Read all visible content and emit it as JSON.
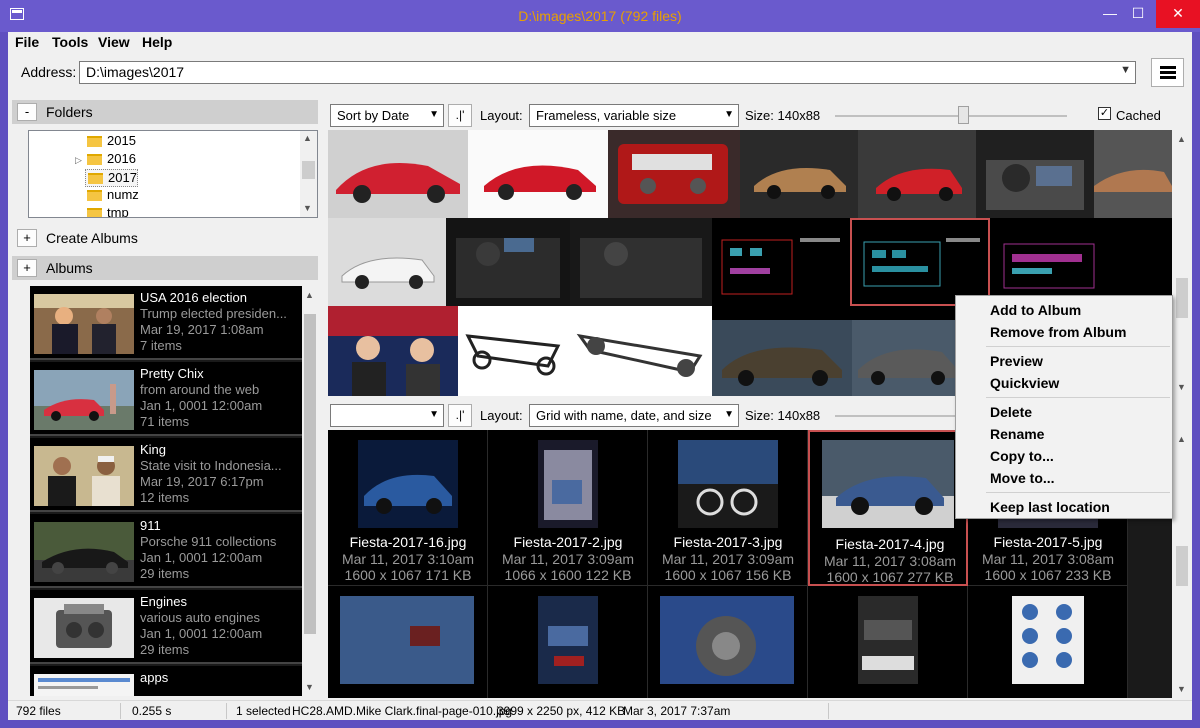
{
  "window": {
    "title": "D:\\images\\2017 (792 files)",
    "minimize": "—",
    "maximize": "☐",
    "close": "✕"
  },
  "menu": [
    "File",
    "Tools",
    "View",
    "Help"
  ],
  "address": {
    "label": "Address:",
    "value": "D:\\images\\2017"
  },
  "folders": {
    "header": "Folders",
    "toggle": "-",
    "items": [
      "2015",
      "2016",
      "2017",
      "numz",
      "tmp"
    ],
    "selected": "2017"
  },
  "create_albums": {
    "toggle": "+",
    "label": "Create Albums"
  },
  "albums": {
    "toggle": "+",
    "header": "Albums",
    "items": [
      {
        "title": "USA 2016 election",
        "desc": "Trump elected presiden...",
        "date": "Mar 19, 2017 1:08am",
        "count": "7 items"
      },
      {
        "title": "Pretty Chix",
        "desc": "from around the web",
        "date": "Jan 1, 0001 12:00am",
        "count": "71 items"
      },
      {
        "title": "King",
        "desc": "State visit to Indonesia...",
        "date": "Mar 19, 2017 6:17pm",
        "count": "12 items"
      },
      {
        "title": "911",
        "desc": "Porsche 911 collections",
        "date": "Jan 1, 0001 12:00am",
        "count": "29 items"
      },
      {
        "title": "Engines",
        "desc": "various auto engines",
        "date": "Jan 1, 0001 12:00am",
        "count": "29 items"
      },
      {
        "title": "apps",
        "desc": "",
        "date": "",
        "count": ""
      }
    ]
  },
  "top_toolbar": {
    "sort": "Sort by Date",
    "order_button": ".|'",
    "layout_label": "Layout:",
    "layout": "Frameless, variable size",
    "size_label": "Size: 140x88",
    "size_level": 0.55,
    "cached_label": "Cached",
    "cached_checked": "✓"
  },
  "bottom_toolbar": {
    "sort": "",
    "order_button": ".|'",
    "layout_label": "Layout:",
    "layout": "Grid with name, date, and size",
    "size_label": "Size: 140x88",
    "size_level": 0.55
  },
  "grid_items": [
    {
      "name": "Fiesta-2017-16.jpg",
      "date": "Mar 11, 2017 3:10am",
      "size": "1600 x 1067  171 KB"
    },
    {
      "name": "Fiesta-2017-2.jpg",
      "date": "Mar 11, 2017 3:09am",
      "size": "1066 x 1600  122 KB"
    },
    {
      "name": "Fiesta-2017-3.jpg",
      "date": "Mar 11, 2017 3:09am",
      "size": "1600 x 1067  156 KB"
    },
    {
      "name": "Fiesta-2017-4.jpg",
      "date": "Mar 11, 2017 3:08am",
      "size": "1600 x 1067  277 KB"
    },
    {
      "name": "Fiesta-2017-5.jpg",
      "date": "Mar 11, 2017 3:08am",
      "size": "1600 x 1067  233 KB"
    }
  ],
  "context_menu": {
    "items": [
      "Add to Album",
      "Remove from Album",
      "Preview",
      "Quickview",
      "Delete",
      "Rename",
      "Copy to...",
      "Move to...",
      "Keep last location"
    ]
  },
  "status": {
    "files": "792 files",
    "time": "0.255 s",
    "selected": "1 selected",
    "filename": "HC28.AMD.Mike Clark.final-page-010.jpg",
    "dims": "3999 x 2250 px, 412 KB",
    "date": "Mar 3, 2017 7:37am"
  },
  "colors": {
    "titlebar": "#6a5acd",
    "title_text": "#e8a000",
    "close": "#e81123",
    "highlight": "#c85050"
  }
}
